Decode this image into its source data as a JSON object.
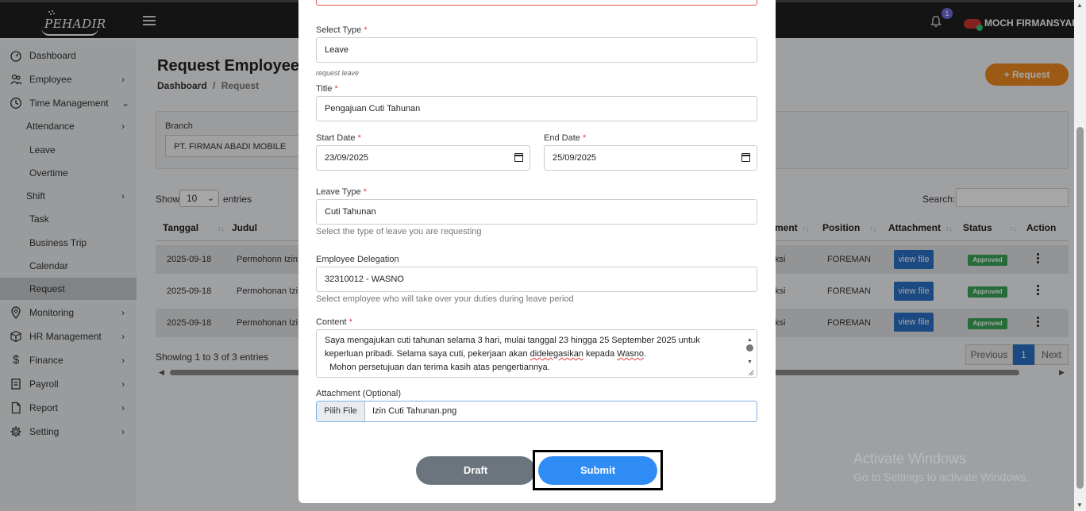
{
  "header": {
    "logo_text": "PEHADIR",
    "notification_count": "1",
    "user_name": "MOCH FIRMANSYAH"
  },
  "sidebar": {
    "items": [
      {
        "label": "Dashboard",
        "icon": "dashboard-icon"
      },
      {
        "label": "Employee",
        "icon": "users-icon"
      },
      {
        "label": "Time Management",
        "icon": "clock-icon"
      },
      {
        "label": "Attendance"
      },
      {
        "label": "Leave"
      },
      {
        "label": "Overtime"
      },
      {
        "label": "Shift"
      },
      {
        "label": "Task"
      },
      {
        "label": "Business Trip"
      },
      {
        "label": "Calendar"
      },
      {
        "label": "Request"
      },
      {
        "label": "Monitoring",
        "icon": "map-pin-icon"
      },
      {
        "label": "HR Management",
        "icon": "box-icon"
      },
      {
        "label": "Finance",
        "icon": "dollar-icon"
      },
      {
        "label": "Payroll",
        "icon": "receipt-icon"
      },
      {
        "label": "Report",
        "icon": "file-icon"
      },
      {
        "label": "Setting",
        "icon": "gear-icon"
      }
    ]
  },
  "page": {
    "title": "Request Employee",
    "breadcrumb_home": "Dashboard",
    "breadcrumb_sep": "/",
    "breadcrumb_current": "Request",
    "request_button": "+ Request",
    "branch_label": "Branch",
    "branch_value": "PT. FIRMAN ABADI MOBILE",
    "show_label": "Show",
    "show_value": "10",
    "entries_label": "entries",
    "search_label": "Search:",
    "showing_text": "Showing 1 to 3 of 3 entries",
    "pager": {
      "prev": "Previous",
      "current": "1",
      "next": "Next"
    }
  },
  "table": {
    "headers": {
      "tanggal": "Tanggal",
      "judul": "Judul",
      "department": "ment",
      "position": "Position",
      "attachment": "Attachment",
      "status": "Status",
      "action": "Action"
    },
    "rows": [
      {
        "tanggal": "2025-09-18",
        "judul": "Permohonn Izin",
        "department": "ksi",
        "position": "FOREMAN",
        "attachment": "view file",
        "status": "Approved"
      },
      {
        "tanggal": "2025-09-18",
        "judul": "Permohonan Izi",
        "department": "ksi",
        "position": "FOREMAN",
        "attachment": "view file",
        "status": "Approved"
      },
      {
        "tanggal": "2025-09-18",
        "judul": "Permohonan Izi",
        "department": "ksi",
        "position": "FOREMAN",
        "attachment": "view file",
        "status": "Approved"
      }
    ]
  },
  "modal": {
    "select_type": {
      "label": "Select Type",
      "value": "Leave",
      "help": "request leave"
    },
    "title": {
      "label": "Title",
      "value": "Pengajuan Cuti Tahunan"
    },
    "start_date": {
      "label": "Start Date",
      "value": "23/09/2025"
    },
    "end_date": {
      "label": "End Date",
      "value": "25/09/2025"
    },
    "leave_type": {
      "label": "Leave Type",
      "value": "Cuti Tahunan",
      "help": "Select the type of leave you are requesting"
    },
    "delegation": {
      "label": "Employee Delegation",
      "value": "32310012 - WASNO",
      "help": "Select employee who will take over your duties during leave period"
    },
    "content": {
      "label": "Content",
      "line1": "Saya mengajukan cuti tahunan selama 3 hari, mulai tanggal 23 hingga 25 September 2025 untuk",
      "line2_a": "keperluan pribadi. Selama saya cuti, pekerjaan akan ",
      "line2_b": "didelegasikan",
      "line2_c": " kepada ",
      "line2_d": "Wasno",
      "line2_e": ".",
      "line3": "  Mohon persetujuan dan terima kasih atas pengertiannya."
    },
    "attachment": {
      "label": "Attachment (Optional)",
      "button": "Pilih File",
      "file_name": "Izin Cuti Tahunan.png"
    },
    "required_mark": "*",
    "draft_button": "Draft",
    "submit_button": "Submit"
  },
  "watermark": {
    "line1": "Activate Windows",
    "line2": "Go to Settings to activate Windows."
  },
  "colors": {
    "topbar": "#1f1f1f",
    "request_button": "#f08a1f",
    "primary": "#2f8cf5",
    "draft": "#6c757d",
    "approved": "#3aa756",
    "required": "#e23c3c"
  }
}
